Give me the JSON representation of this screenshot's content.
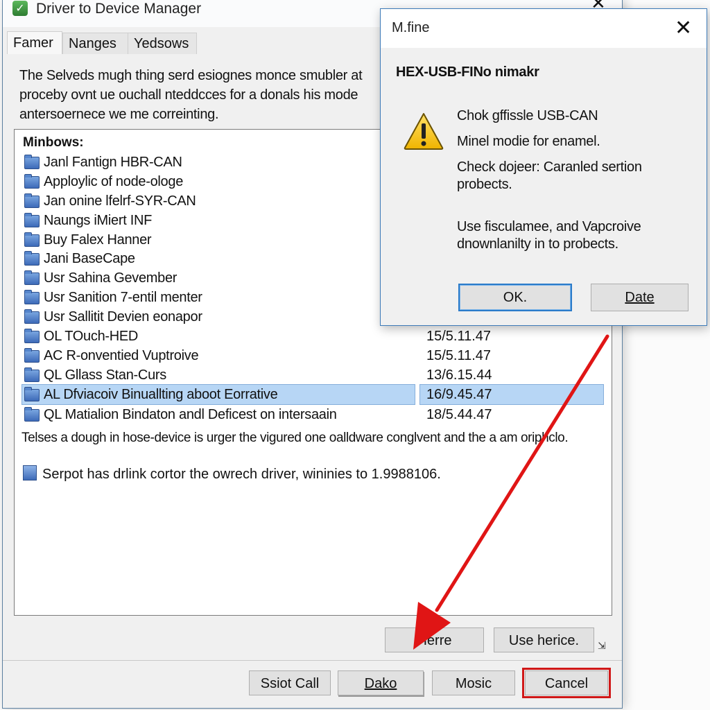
{
  "main_window": {
    "title": "Driver to Device Manager",
    "close_glyph": "✕",
    "app_icon": "checkmark-shield-icon",
    "tabs": [
      {
        "label": "Famer",
        "active": true
      },
      {
        "label": "Nanges",
        "active": false
      },
      {
        "label": "Yedsows",
        "active": false
      }
    ],
    "intro_lines": [
      "The Selveds mugh thing serd esiognes monce smubler at",
      "proceby ovnt ue ouchall nteddcces for a donals his mode",
      "antersoernece we me correinting."
    ],
    "list": {
      "header": "Minbows:",
      "items": [
        {
          "name": "Janl Fantign HBR-CAN",
          "date": ""
        },
        {
          "name": "Apploylic of node-ologe",
          "date": ""
        },
        {
          "name": "Jan onine lfelrf-SYR-CAN",
          "date": ""
        },
        {
          "name": "Naungs iMiert INF",
          "date": ""
        },
        {
          "name": "Buy Falex Hanner",
          "date": ""
        },
        {
          "name": "Jani BaseCape",
          "date": ""
        },
        {
          "name": "Usr Sahina Gevember",
          "date": ""
        },
        {
          "name": "Usr Sanition 7-entil menter",
          "date": ""
        },
        {
          "name": "Usr Sallitit Devien eonapor",
          "date": ""
        },
        {
          "name": "OL TOuch-HED",
          "date": "15/5.11.47"
        },
        {
          "name": "AC R-onventied Vuptroive",
          "date": "15/5.11.47"
        },
        {
          "name": "QL Gllass Stan-Curs",
          "date": "13/6.15.44"
        },
        {
          "name": "AL Dfviacoiv Binuallting aboot Eorrative",
          "date": "16/9.45.47",
          "selected": true
        },
        {
          "name": "QL Matialion Bindaton andl Deficest on intersaain",
          "date": "18/5.44.47"
        }
      ],
      "description": "Telses a dough in hose-device is urger the vigured one oalldware conglvent and the a am oriphclo.",
      "note": "Serpot has drlink cortor the owrech driver, wininies to 1.9988106."
    },
    "inner_buttons": {
      "here": "Herre",
      "use_here": "Use herice."
    },
    "footer_buttons": {
      "start_call": "Ssiot Call",
      "dako": "Dako",
      "mosic": "Mosic",
      "cancel": "Cancel"
    },
    "highlight_color": "#d01818"
  },
  "dialog": {
    "title": "M.fine",
    "close_glyph": "✕",
    "heading": "HEX-USB-FINo nimakr",
    "icon": "warning-icon",
    "lines": [
      "Chok gffissle USB-CAN",
      "Minel modie for enamel.",
      "Check dojeer: Caranled sertion probects.",
      "Use fisculamee, and Vapcroive dnownlanilty in to probects."
    ],
    "buttons": {
      "ok": "OK.",
      "date": "Date"
    }
  },
  "annotation": {
    "type": "red-arrow",
    "color": "#e01515"
  }
}
